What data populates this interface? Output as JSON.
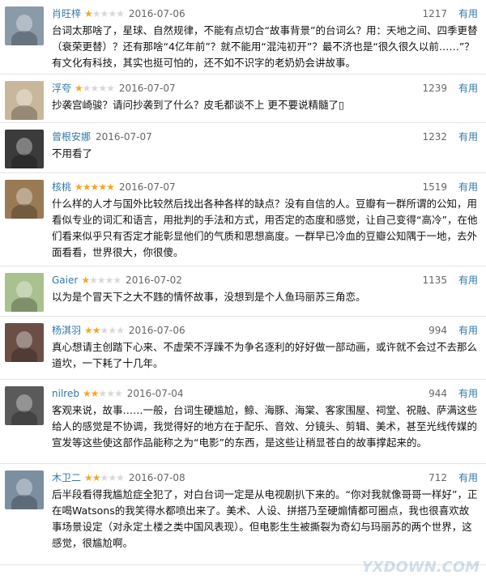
{
  "reviews": [
    {
      "user": "肖旺梓",
      "rating": 1,
      "date": "2016-07-06",
      "votes": "1217",
      "useful": "有用",
      "content": "台词太那啥了，星球、自然规律，不能有点切合“故事背景”的台词么？用：天地之间、四季更替（衰荣更替）？还有那啥“4亿年前”？就不能用“混沌初开”？最不济也是“很久很久以前……”？有文化有科技，其实也挺可怕的，还不如不识字的老奶奶会讲故事。",
      "avatar_color": "#8a9aa8"
    },
    {
      "user": "浮夸",
      "rating": 1,
      "date": "2016-07-07",
      "votes": "1239",
      "useful": "有用",
      "content": "抄袭宫崎骏？请问抄袭到了什么？皮毛都谈不上 更不要说精髓了▯",
      "avatar_color": "#c9b79c"
    },
    {
      "user": "曾根安娜",
      "rating": 0,
      "date": "2016-07-07",
      "votes": "1232",
      "useful": "有用",
      "content": "不用看了",
      "avatar_color": "#3b3b3b"
    },
    {
      "user": "核桃",
      "rating": 5,
      "date": "2016-07-07",
      "votes": "1519",
      "useful": "有用",
      "content": "什么样的人才与国外比较然后找出各种各样的缺点？没有自信的人。豆瓣有一群所谓的公知，用看似专业的词汇和语言，用批判的手法和方式，用否定的态度和感觉，让自己变得“高冷”，在他们看来似乎只有否定才能彰显他们的气质和思想高度。一群早已冷血的豆瓣公知隅于一地，去外面看看，世界很大，你很傻。",
      "avatar_color": "#9a7a55"
    },
    {
      "user": "Gaier",
      "rating": 1,
      "date": "2016-07-02",
      "votes": "1135",
      "useful": "有用",
      "content": "以为是个冒天下之大不韪的情怀故事，没想到是个人鱼玛丽苏三角恋。",
      "avatar_color": "#a9c08f"
    },
    {
      "user": "杨淇羽",
      "rating": 2,
      "date": "2016-07-06",
      "votes": "994",
      "useful": "有用",
      "content": "真心想请主创踏下心来、不虚荣不浮躁不为争名逐利的好好做一部动画，或许就不会过不去那么道坎，一下耗了十几年。",
      "avatar_color": "#6b4f47"
    },
    {
      "user": "nilreb",
      "rating": 2,
      "date": "2016-07-04",
      "votes": "944",
      "useful": "有用",
      "content": "客观来说，故事……一般，台词生硬尴尬，鲸、海豚、海棠、客家围屋、祠堂、祝融、萨满这些给人的感觉是不协调，我觉得好的地方在于配乐、音效、分镜头、剪辑、美术，甚至光线传媒的宣发等这些使这部作品能称之为“电影”的东西，是这些让稍显苍白的故事撑起来的。",
      "avatar_color": "#5a5a5a"
    },
    {
      "user": "木卫二",
      "rating": 2,
      "date": "2016-07-08",
      "votes": "712",
      "useful": "有用",
      "content": "后半段看得我尴尬症全犯了，对白台词一定是从电视剧扒下来的。“你对我就像哥哥一样好”，正在喝Watsons的我笑得水都喷出来了。美术、人设、拼搭乃至硬煽情都可圈点，我也很喜欢故事场景设定（对永定土楼之类中国风表现）。但电影生生被撕裂为奇幻与玛丽苏的两个世界，这感觉，很尴尬啊。",
      "avatar_color": "#7c8fa0"
    }
  ],
  "watermark": "YXDOWN.COM",
  "colors": {
    "link": "#3377aa",
    "star": "#f5a623"
  }
}
